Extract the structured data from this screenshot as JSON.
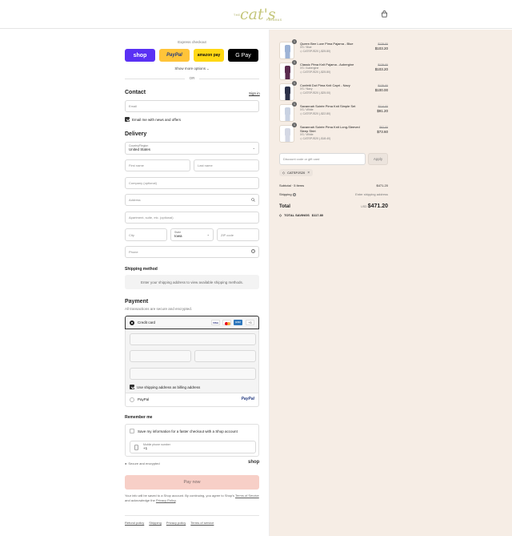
{
  "header": {
    "logo_small_top": "THE",
    "logo_script": "cat's",
    "logo_small_bottom": "PAJAMAS"
  },
  "express": {
    "title": "Express checkout",
    "shop": "shop",
    "paypal": "PayPal",
    "amazon": "amazon pay",
    "gpay": "G Pay",
    "more": "Show more options",
    "or": "OR"
  },
  "contact": {
    "title": "Contact",
    "sign_in": "Sign in",
    "email_placeholder": "Email",
    "news": "Email me with news and offers"
  },
  "delivery": {
    "title": "Delivery",
    "country_label": "Country/Region",
    "country_value": "United States",
    "first": "First name",
    "last": "Last name",
    "company": "Company (optional)",
    "address": "Address",
    "apartment": "Apartment, suite, etc. (optional)",
    "city": "City",
    "state_label": "State",
    "state_value": "Iowa",
    "zip": "ZIP code",
    "phone": "Phone"
  },
  "shipping": {
    "title": "Shipping method",
    "message": "Enter your shipping address to view available shipping methods."
  },
  "payment": {
    "title": "Payment",
    "subtitle": "All transactions are secure and encrypted.",
    "credit_card": "Credit card",
    "more_cards": "+3",
    "billing": "Use shipping address as billing address",
    "paypal_option": "PayPal",
    "paypal_logo": "PayPal"
  },
  "remember": {
    "title": "Remember me",
    "save": "Save my information for a faster checkout with a Shop account",
    "mobile_label": "Mobile phone number",
    "mobile_value": "+1",
    "secure": "Secure and encrypted",
    "shop": "shop"
  },
  "pay": {
    "button": "Pay now",
    "disclaimer_1": "Your info will be saved to a Shop account. By continuing, you agree to Shop's",
    "terms": "Terms of Service",
    "and": "and acknowledge the",
    "privacy": "Privacy Policy",
    "period": "."
  },
  "footer": {
    "links": [
      "Refund policy",
      "Shipping",
      "Privacy policy",
      "Terms of service"
    ]
  },
  "cart": {
    "items": [
      {
        "qty": "1",
        "name": "Queen Bee Luxe Pima Pajama - Blue",
        "variant": "XS / Blue",
        "code": "CATSPJS20 (-$25.80)",
        "old": "$129.00",
        "price": "$103.20",
        "color": "#9db3d6"
      },
      {
        "qty": "1",
        "name": "Classic Pima Knit Pajama - Aubergine",
        "variant": "XS / Aubergine",
        "code": "CATSPJS20 (-$25.80)",
        "old": "$129.00",
        "price": "$103.20",
        "color": "#5a2a4e"
      },
      {
        "qty": "1",
        "name": "Confetti Dot Pima Knit Capri - Navy",
        "variant": "XS / Navy",
        "code": "CATSPJS20 (-$25.00)",
        "old": "$125.00",
        "price": "$100.00",
        "color": "#2b3048"
      },
      {
        "qty": "1",
        "name": "Savannah Soirée Pima Knit Simple Set",
        "variant": "XS / White",
        "code": "CATSPJS20 (-$22.80)",
        "old": "$114.00",
        "price": "$91.20",
        "color": "#c9d2e2"
      },
      {
        "qty": "1",
        "name": "Savannah Soirée Pima Knit Long-Sleeved Sleep Shirt",
        "variant": "XS / White",
        "code": "CATSPJS20 (-$18.40)",
        "old": "$92.00",
        "price": "$73.60",
        "color": "#d4d8e4"
      }
    ],
    "discount_placeholder": "Discount code or gift card",
    "apply": "Apply",
    "code_tag": "CATSPJS20",
    "subtotal_label": "Subtotal · 5 items",
    "subtotal": "$471.20",
    "shipping_label": "Shipping",
    "shipping_value": "Enter shipping address",
    "total_label": "Total",
    "currency": "USD",
    "total": "$471.20",
    "savings_label": "TOTAL SAVINGS",
    "savings": "$117.80"
  },
  "colors": {
    "shop": "#5a31f4",
    "paypal": "#ffc439",
    "amazon": "#ffd814",
    "gpay": "#000000",
    "pay_button": "#f7cfc7",
    "sidebar": "#f6ede5"
  }
}
